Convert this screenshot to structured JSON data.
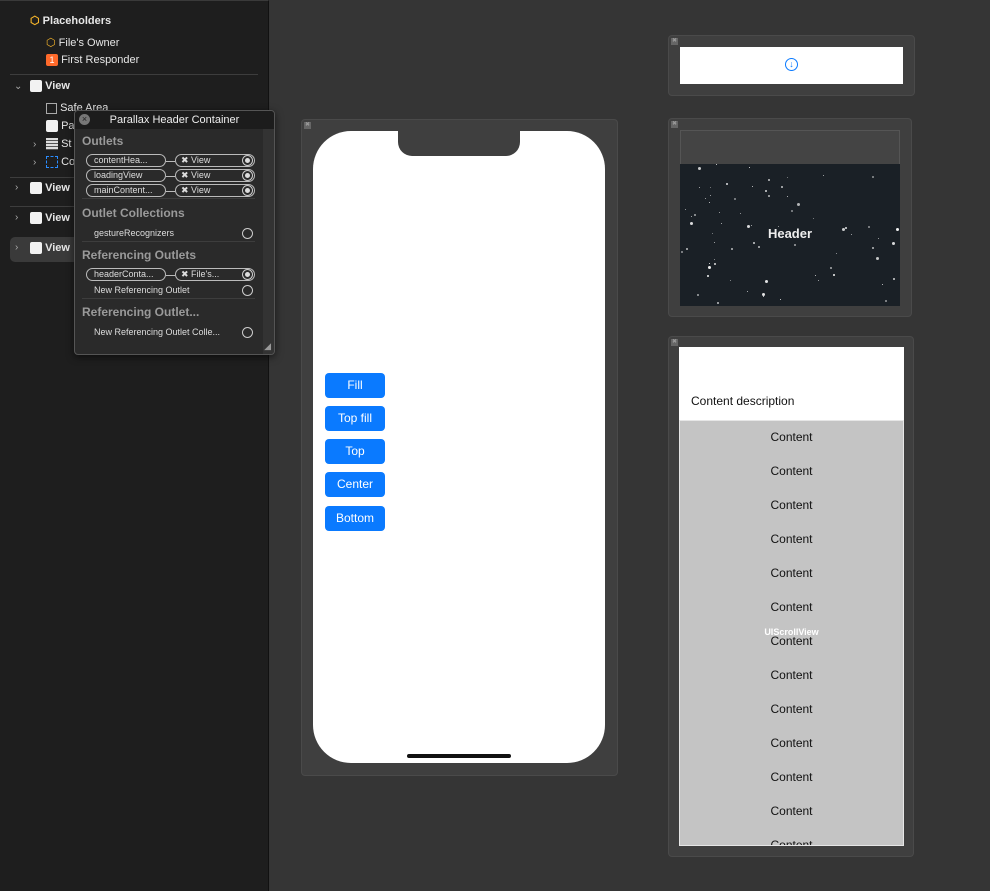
{
  "sidebar": {
    "placeholders_label": "Placeholders",
    "files_owner": "File's Owner",
    "first_responder": "First Responder",
    "first_responder_badge": "1",
    "view_1": "View",
    "safe_area": "Safe Area",
    "parallax_partial": "Pa",
    "stack_partial": "St",
    "container_partial": "Co",
    "view_2": "View",
    "view_3": "View",
    "view_4": "View"
  },
  "popup": {
    "title": "Parallax Header Container",
    "outlets_label": "Outlets",
    "outlets": [
      {
        "name": "contentHea...",
        "target": "View"
      },
      {
        "name": "loadingView",
        "target": "View"
      },
      {
        "name": "mainContent...",
        "target": "View"
      }
    ],
    "outlet_collections_label": "Outlet Collections",
    "gesture_recognizers": "gestureRecognizers",
    "referencing_outlets_label": "Referencing Outlets",
    "referencing_outlet": {
      "name": "headerConta...",
      "target": "File's..."
    },
    "new_referencing_outlet": "New Referencing Outlet",
    "referencing_collections_label": "Referencing Outlet...",
    "new_referencing_collection": "New Referencing Outlet Colle..."
  },
  "phone": {
    "buttons": [
      "Fill",
      "Top fill",
      "Top",
      "Center",
      "Bottom"
    ]
  },
  "header_scene": {
    "title": "Header"
  },
  "content_scene": {
    "description": "Content description",
    "scroll_label": "UIScrollView",
    "items": [
      "Content",
      "Content",
      "Content",
      "Content",
      "Content",
      "Content",
      "Content",
      "Content",
      "Content",
      "Content",
      "Content",
      "Content",
      "Content"
    ]
  },
  "colors": {
    "accent": "#0a7aff",
    "header_bg": "#1a2026",
    "content_bg": "#c4c4c4",
    "badge": "#ff6a2b"
  }
}
